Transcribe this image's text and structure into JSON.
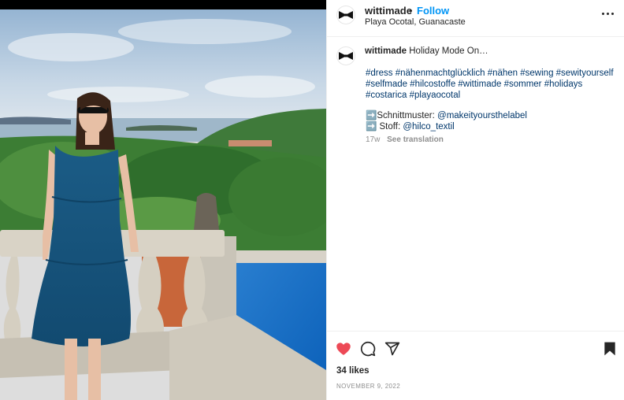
{
  "post": {
    "username": "wittimade",
    "separator": "•",
    "follow_label": "Follow",
    "location": "Playa Ocotal, Guanacaste",
    "caption_user": "wittimade",
    "caption_text": "Holiday Mode On…",
    "hashtags": "#dress #nähenmachtglücklich #nähen #sewing #sewityourself #selfmade #hilcostoffe #wittimade #sommer #holidays #costarica #playaocotal",
    "pattern_label": "➡️Schnittmuster: ",
    "pattern_mention": "@makeityoursthelabel",
    "fabric_label": "➡️ Stoff: ",
    "fabric_mention": "@hilco_textil",
    "age": "17w",
    "translate_label": "See translation",
    "likes": "34 likes",
    "date": "NOVEMBER 9, 2022"
  },
  "icons": {
    "avatar": "bowtie-logo",
    "more": "more-options-icon",
    "like": "heart-icon",
    "comment": "comment-icon",
    "share": "share-icon",
    "save": "bookmark-icon"
  },
  "colors": {
    "follow": "#0095f6",
    "hashtag": "#00376b",
    "like_active": "#ed4956",
    "muted": "#8e8e8e"
  }
}
